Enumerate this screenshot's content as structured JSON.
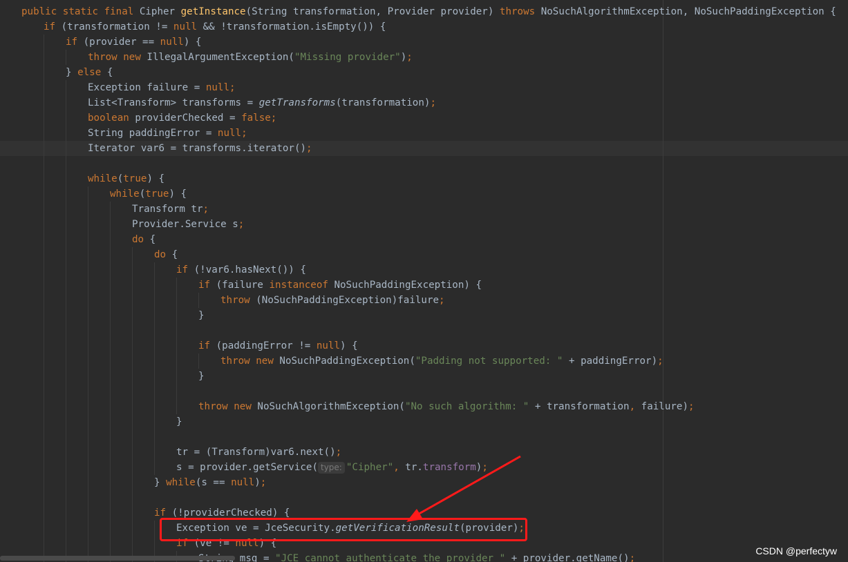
{
  "editor": {
    "lines": [
      {
        "indent": 1,
        "segs": [
          [
            "kw",
            "public static final "
          ],
          [
            "",
            "Cipher "
          ],
          [
            "fn",
            "getInstance"
          ],
          [
            "",
            "(String transformation, Provider provider) "
          ],
          [
            "kw",
            "throws "
          ],
          [
            "",
            "NoSuchAlgorithmException, NoSuchPaddingException {"
          ]
        ]
      },
      {
        "indent": 2,
        "segs": [
          [
            "kw",
            "if "
          ],
          [
            "",
            "(transformation != "
          ],
          [
            "kw",
            "null "
          ],
          [
            "",
            "&& !transformation.isEmpty()) {"
          ]
        ]
      },
      {
        "indent": 3,
        "segs": [
          [
            "kw",
            "if "
          ],
          [
            "",
            "(provider == "
          ],
          [
            "kw",
            "null"
          ],
          [
            "",
            ") {"
          ]
        ]
      },
      {
        "indent": 4,
        "segs": [
          [
            "kw",
            "throw new "
          ],
          [
            "",
            "IllegalArgumentException("
          ],
          [
            "str",
            "\"Missing provider\""
          ],
          [
            "",
            ")"
          ],
          [
            "kw",
            ";"
          ]
        ]
      },
      {
        "indent": 3,
        "segs": [
          [
            "",
            "} "
          ],
          [
            "kw",
            "else "
          ],
          [
            "",
            "{"
          ]
        ]
      },
      {
        "indent": 4,
        "segs": [
          [
            "",
            "Exception failure = "
          ],
          [
            "kw",
            "null;"
          ]
        ]
      },
      {
        "indent": 4,
        "segs": [
          [
            "",
            "List<Transform> transforms = "
          ],
          [
            "it",
            "getTransforms"
          ],
          [
            "",
            "(transformation)"
          ],
          [
            "kw",
            ";"
          ]
        ]
      },
      {
        "indent": 4,
        "segs": [
          [
            "kw",
            "boolean "
          ],
          [
            "",
            "providerChecked = "
          ],
          [
            "kw",
            "false;"
          ]
        ]
      },
      {
        "indent": 4,
        "segs": [
          [
            "",
            "String paddingError = "
          ],
          [
            "kw",
            "null;"
          ]
        ]
      },
      {
        "indent": 4,
        "segs": [
          [
            "",
            "Iterator var6 = transforms.iterator()"
          ],
          [
            "kw",
            ";"
          ]
        ]
      },
      {
        "indent": 0,
        "segs": []
      },
      {
        "indent": 4,
        "segs": [
          [
            "kw",
            "while"
          ],
          [
            "",
            "("
          ],
          [
            "kw",
            "true"
          ],
          [
            "",
            ") {"
          ]
        ]
      },
      {
        "indent": 5,
        "segs": [
          [
            "kw",
            "while"
          ],
          [
            "",
            "("
          ],
          [
            "kw",
            "true"
          ],
          [
            "",
            ") {"
          ]
        ]
      },
      {
        "indent": 6,
        "segs": [
          [
            "",
            "Transform tr"
          ],
          [
            "kw",
            ";"
          ]
        ]
      },
      {
        "indent": 6,
        "segs": [
          [
            "",
            "Provider.Service s"
          ],
          [
            "kw",
            ";"
          ]
        ]
      },
      {
        "indent": 6,
        "segs": [
          [
            "kw",
            "do "
          ],
          [
            "",
            "{"
          ]
        ]
      },
      {
        "indent": 7,
        "segs": [
          [
            "kw",
            "do "
          ],
          [
            "",
            "{"
          ]
        ]
      },
      {
        "indent": 8,
        "segs": [
          [
            "kw",
            "if "
          ],
          [
            "",
            "(!var6.hasNext()) {"
          ]
        ]
      },
      {
        "indent": 9,
        "segs": [
          [
            "kw",
            "if "
          ],
          [
            "",
            "(failure "
          ],
          [
            "kw",
            "instanceof "
          ],
          [
            "",
            "NoSuchPaddingException) {"
          ]
        ]
      },
      {
        "indent": 10,
        "segs": [
          [
            "kw",
            "throw "
          ],
          [
            "",
            "(NoSuchPaddingException)failure"
          ],
          [
            "kw",
            ";"
          ]
        ]
      },
      {
        "indent": 9,
        "segs": [
          [
            "",
            "}"
          ]
        ]
      },
      {
        "indent": 0,
        "segs": []
      },
      {
        "indent": 9,
        "segs": [
          [
            "kw",
            "if "
          ],
          [
            "",
            "(paddingError != "
          ],
          [
            "kw",
            "null"
          ],
          [
            "",
            ") {"
          ]
        ]
      },
      {
        "indent": 10,
        "segs": [
          [
            "kw",
            "throw new "
          ],
          [
            "",
            "NoSuchPaddingException("
          ],
          [
            "str",
            "\"Padding not supported: \" "
          ],
          [
            "",
            "+ paddingError)"
          ],
          [
            "kw",
            ";"
          ]
        ]
      },
      {
        "indent": 9,
        "segs": [
          [
            "",
            "}"
          ]
        ]
      },
      {
        "indent": 0,
        "segs": []
      },
      {
        "indent": 9,
        "segs": [
          [
            "kw",
            "throw new "
          ],
          [
            "",
            "NoSuchAlgorithmException("
          ],
          [
            "str",
            "\"No such algorithm: \" "
          ],
          [
            "",
            "+ transformation"
          ],
          [
            "kw",
            ", "
          ],
          [
            "",
            "failure)"
          ],
          [
            "kw",
            ";"
          ]
        ]
      },
      {
        "indent": 8,
        "segs": [
          [
            "",
            "}"
          ]
        ]
      },
      {
        "indent": 0,
        "segs": []
      },
      {
        "indent": 8,
        "segs": [
          [
            "",
            "tr = (Transform)var6.next()"
          ],
          [
            "kw",
            ";"
          ]
        ]
      },
      {
        "indent": 8,
        "segs": [
          [
            "",
            "s = provider.getService("
          ],
          [
            "hint",
            "type:"
          ],
          [
            "str",
            "\"Cipher\""
          ],
          [
            "kw",
            ", "
          ],
          [
            "",
            "tr."
          ],
          [
            "fld",
            "transform"
          ],
          [
            "",
            ")"
          ],
          [
            "kw",
            ";"
          ]
        ]
      },
      {
        "indent": 7,
        "segs": [
          [
            "",
            "} "
          ],
          [
            "kw",
            "while"
          ],
          [
            "",
            "(s == "
          ],
          [
            "kw",
            "null"
          ],
          [
            "",
            ")"
          ],
          [
            "kw",
            ";"
          ]
        ]
      },
      {
        "indent": 0,
        "segs": []
      },
      {
        "indent": 7,
        "segs": [
          [
            "kw",
            "if "
          ],
          [
            "",
            "(!providerChecked) {"
          ]
        ]
      },
      {
        "indent": 8,
        "segs": [
          [
            "",
            "Exception ve = JceSecurity."
          ],
          [
            "it",
            "getVerificationResult"
          ],
          [
            "",
            "(provider)"
          ],
          [
            "kw",
            ";"
          ]
        ]
      },
      {
        "indent": 8,
        "segs": [
          [
            "kw",
            "if "
          ],
          [
            "",
            "(ve != "
          ],
          [
            "kw",
            "null"
          ],
          [
            "",
            ") {"
          ]
        ]
      },
      {
        "indent": 9,
        "segs": [
          [
            "",
            "String msg = "
          ],
          [
            "str",
            "\"JCE cannot authenticate the provider \" "
          ],
          [
            "",
            "+ provider.getName()"
          ],
          [
            "kw",
            ";"
          ]
        ]
      }
    ]
  },
  "watermark": "CSDN @perfectyw",
  "colors": {
    "background": "#2b2b2b",
    "keyword": "#cc7832",
    "method_decl": "#ffc66d",
    "string": "#6a8759",
    "field": "#9876aa",
    "highlight": "#ff1a1a"
  }
}
